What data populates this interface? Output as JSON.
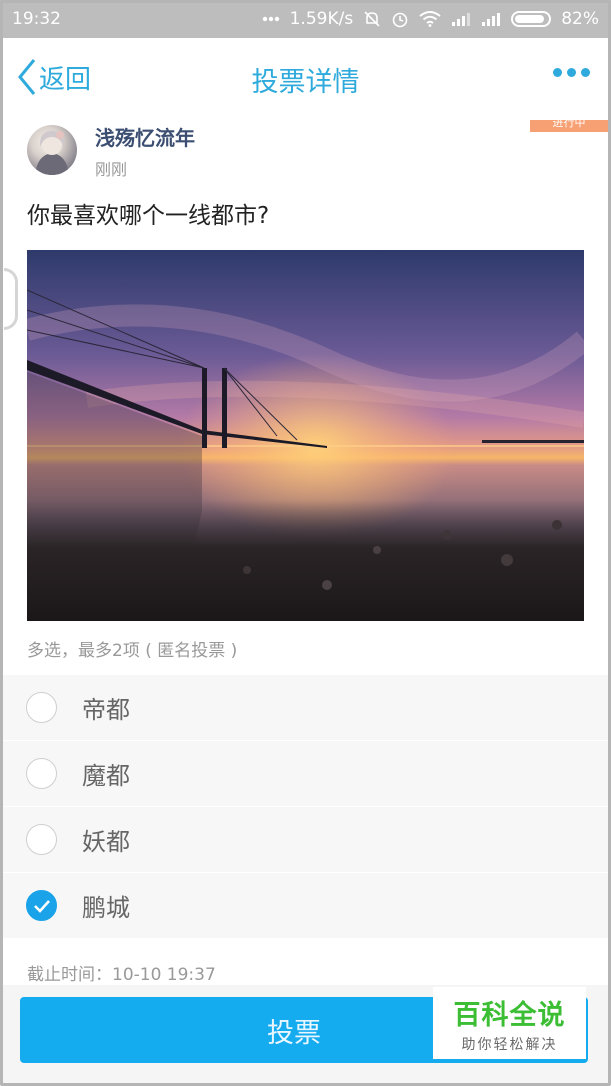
{
  "statusbar": {
    "time": "19:32",
    "network_speed": "1.59K/s",
    "battery": "82%",
    "icons": [
      "dots-icon",
      "mute-icon",
      "alarm-icon",
      "wifi-icon",
      "signal-icon",
      "signal-icon",
      "battery-icon"
    ]
  },
  "nav": {
    "back_label": "返回",
    "title": "投票详情",
    "more_icon": "more-dots-icon"
  },
  "post": {
    "ribbon": "进行中",
    "username": "浅殇忆流年",
    "time": "刚刚",
    "question": "你最喜欢哪个一线都市?",
    "image": "bridge-sunset-photo"
  },
  "vote": {
    "hint": "多选，最多2项 ( 匿名投票 )",
    "options": [
      {
        "label": "帝都",
        "checked": false
      },
      {
        "label": "魔都",
        "checked": false
      },
      {
        "label": "妖都",
        "checked": false
      },
      {
        "label": "鹏城",
        "checked": true
      }
    ],
    "deadline": "截止时间：10-10 19:37",
    "submit_label": "投票"
  },
  "watermark": {
    "title": "百科全说",
    "subtitle": "助你轻松解决"
  },
  "colors": {
    "accent": "#2eaadc",
    "button": "#15abef",
    "watermark_green": "#3cbe34",
    "ribbon": "#f7a074"
  }
}
